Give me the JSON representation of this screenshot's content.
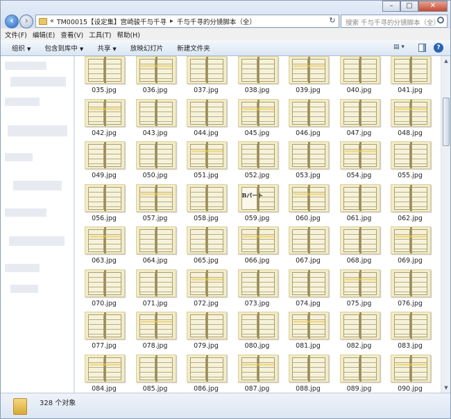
{
  "window": {
    "breadcrumb": [
      "TM00015【设定集】宫崎骏千与千寻",
      "千与千寻的分镜脚本（全）"
    ],
    "breadcrumb_prefix": "«",
    "search_placeholder": "搜索 千与千寻的分镜脚本（全）"
  },
  "menu": [
    "文件(F)",
    "编辑(E)",
    "查看(V)",
    "工具(T)",
    "帮助(H)"
  ],
  "commands": [
    {
      "label": "组织",
      "dropdown": true
    },
    {
      "label": "包含到库中",
      "dropdown": true
    },
    {
      "label": "共享",
      "dropdown": true
    },
    {
      "label": "放映幻灯片",
      "dropdown": false
    },
    {
      "label": "新建文件夹",
      "dropdown": false
    }
  ],
  "files": [
    "035.jpg",
    "036.jpg",
    "037.jpg",
    "038.jpg",
    "039.jpg",
    "040.jpg",
    "041.jpg",
    "042.jpg",
    "043.jpg",
    "044.jpg",
    "045.jpg",
    "046.jpg",
    "047.jpg",
    "048.jpg",
    "049.jpg",
    "050.jpg",
    "051.jpg",
    "052.jpg",
    "053.jpg",
    "054.jpg",
    "055.jpg",
    "056.jpg",
    "057.jpg",
    "058.jpg",
    "059.jpg",
    "060.jpg",
    "061.jpg",
    "062.jpg",
    "063.jpg",
    "064.jpg",
    "065.jpg",
    "066.jpg",
    "067.jpg",
    "068.jpg",
    "069.jpg",
    "070.jpg",
    "071.jpg",
    "072.jpg",
    "073.jpg",
    "074.jpg",
    "075.jpg",
    "076.jpg",
    "077.jpg",
    "078.jpg",
    "079.jpg",
    "080.jpg",
    "081.jpg",
    "082.jpg",
    "083.jpg",
    "084.jpg",
    "085.jpg",
    "086.jpg",
    "087.jpg",
    "088.jpg",
    "089.jpg",
    "090.jpg"
  ],
  "thumbnail_text": {
    "059.jpg": "Bパート"
  },
  "status": {
    "count_text": "328 个对象"
  },
  "icons": {
    "back": "arrow-left-icon",
    "forward": "arrow-right-icon",
    "folder": "folder-icon",
    "refresh": "refresh-icon",
    "search": "search-icon",
    "help": "help-icon"
  },
  "colors": {
    "accent": "#2a65b3",
    "thumb_paper": "#f2ecc8"
  }
}
